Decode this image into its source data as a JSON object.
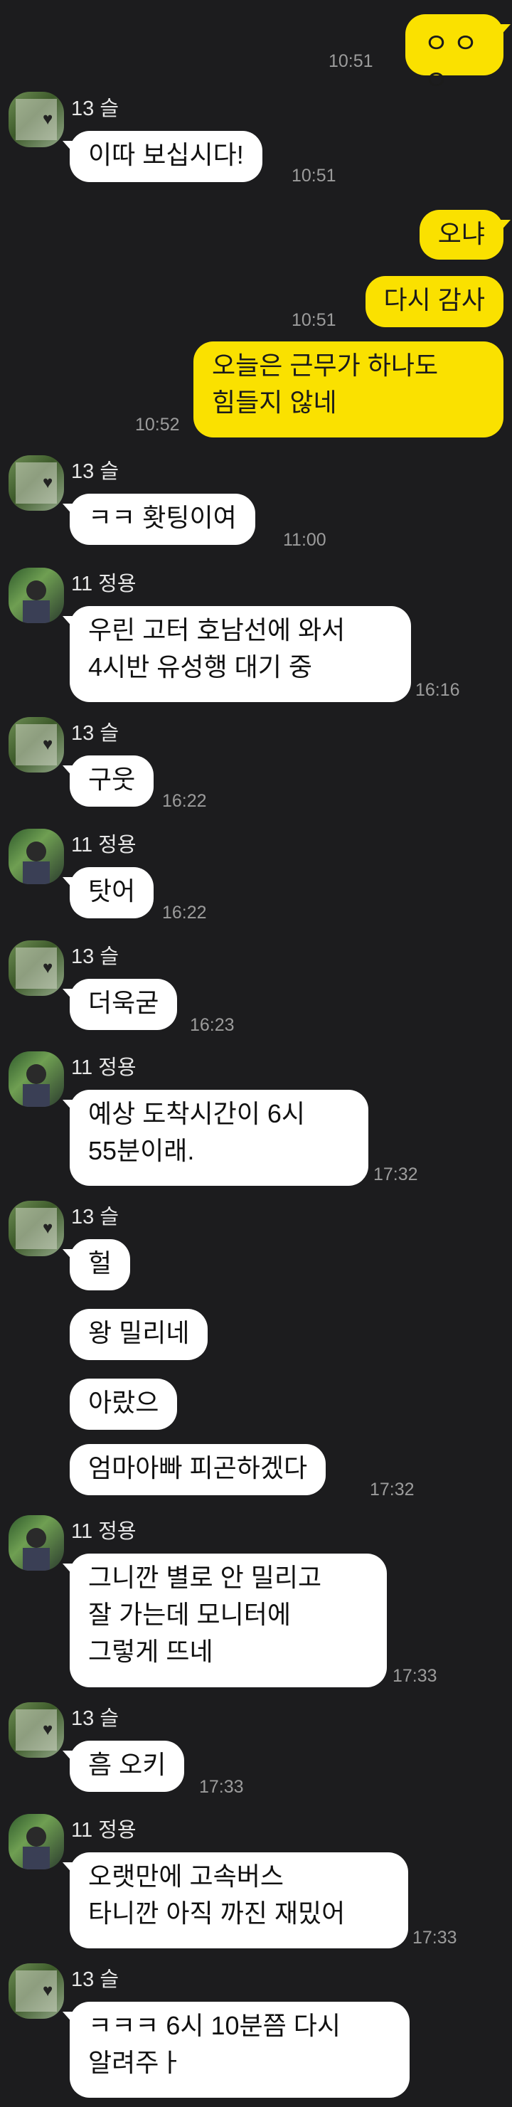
{
  "chat": {
    "m1": {
      "text": "ㅇㅇㅇ",
      "time": "10:51"
    },
    "g1": {
      "sender": "13 슬",
      "text": "이따 보십시다!",
      "time": "10:51"
    },
    "m2": {
      "text": "오냐"
    },
    "m3": {
      "text": "다시 감사",
      "time": "10:51"
    },
    "m4": {
      "text": "오늘은 근무가 하나도\n힘들지 않네",
      "time": "10:52"
    },
    "g2": {
      "sender": "13 슬",
      "text": "ㅋㅋ 홧팅이여",
      "time": "11:00"
    },
    "g3": {
      "sender": "11 정용",
      "text": "우린 고터 호남선에 와서\n4시반 유성행 대기 중",
      "time": "16:16"
    },
    "g4": {
      "sender": "13 슬",
      "text": "구웃",
      "time": "16:22"
    },
    "g5": {
      "sender": "11 정용",
      "text": "탓어",
      "time": "16:22"
    },
    "g6": {
      "sender": "13 슬",
      "text": "더욱굳",
      "time": "16:23"
    },
    "g7": {
      "sender": "11 정용",
      "text": "예상 도착시간이 6시\n55분이래.",
      "time": "17:32"
    },
    "g8": {
      "sender": "13 슬",
      "t1": "헐",
      "t2": "왕 밀리네",
      "t3": "아랐으",
      "t4": "엄마아빠 피곤하겠다",
      "time": "17:32"
    },
    "g9": {
      "sender": "11 정용",
      "text": "그니깐 별로 안 밀리고\n잘 가는데  모니터에\n그렇게 뜨네",
      "time": "17:33"
    },
    "g10": {
      "sender": "13 슬",
      "text": "흠 오키",
      "time": "17:33"
    },
    "g11": {
      "sender": "11 정용",
      "text": "오랫만에 고속버스\n타니깐 아직 까진 재밌어",
      "time": "17:33"
    },
    "g12": {
      "sender": "13 슬",
      "text": "ㅋㅋㅋ 6시 10분쯤 다시\n알려주ㅏ"
    }
  }
}
